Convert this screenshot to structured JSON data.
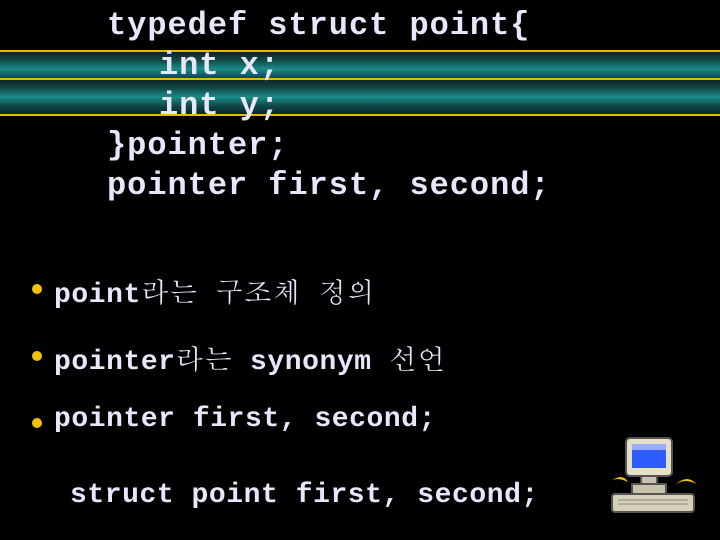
{
  "code": {
    "l1": "typedef struct point{",
    "l2": "int x;",
    "l3": "int y;",
    "l4": "}pointer;",
    "l5": "pointer first, second;"
  },
  "bullets": {
    "b1": "point라는 구조체 정의",
    "b2": "pointer라는 synonym 선언",
    "b3": "pointer first, second;"
  },
  "subline": "struct point first, second;",
  "icons": {
    "computer": "computer-icon"
  }
}
